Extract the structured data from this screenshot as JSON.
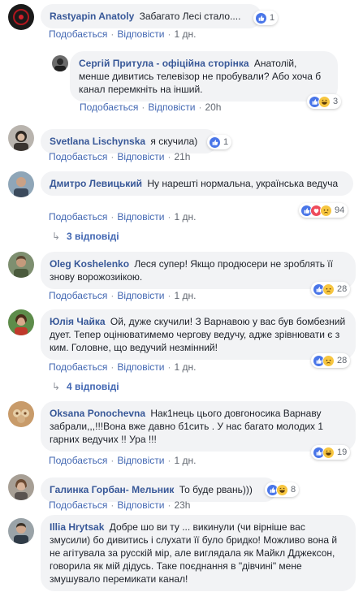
{
  "colors": {
    "name": "#385898",
    "link": "#4267b2",
    "bubble": "#f2f3f5",
    "meta": "#616770"
  },
  "labels": {
    "like": "Подобається",
    "reply": "Відповісти",
    "sep": "·"
  },
  "comments": [
    {
      "name": "Rastyapin Anatoly",
      "text": "Забагато Лесі стало....",
      "time": "1 дн.",
      "reactions": [
        "like"
      ],
      "count": "1"
    },
    {
      "name": "Сергій Притула - офіційна сторінка",
      "text": "Анатолій, менше дивитись телевізор не пробували? Або хоча б канал перемкніть на інший.",
      "time": "20h",
      "reactions": [
        "like",
        "haha"
      ],
      "count": "3"
    },
    {
      "name": "Svetlana Lischynska",
      "text": "я скучила)",
      "time": "21h",
      "reactions": [
        "like"
      ],
      "count": "1"
    },
    {
      "name": "Дмитро Левицький",
      "text": "Ну нарешті нормальна, українська ведуча",
      "time": "1 дн.",
      "reactions": [
        "like",
        "love",
        "sad"
      ],
      "count": "94",
      "replies": "3 відповіді"
    },
    {
      "name": "Oleg Koshelenko",
      "text": "Леся супер! Якщо продюсери не зроблять її знову ворожозиікою.",
      "time": "1 дн.",
      "reactions": [
        "like",
        "sad"
      ],
      "count": "28"
    },
    {
      "name": "Юлія Чайка",
      "text": "Ой, дуже скучили! З Варнавою у вас був бомбезний дует. Тепер оцінюватимемо чергову ведучу, адже зрівнювати є з ким. Головне, що ведучий незмінний!",
      "time": "1 дн.",
      "reactions": [
        "like",
        "sad"
      ],
      "count": "28",
      "replies": "4 відповіді"
    },
    {
      "name": "Oksana Ponochevna",
      "text": "Нак1нець цього довгоносика Варнаву забрали,,,!!!Вона вже давно б1сить . У нас багато молодих 1 гарних ведучих !! Ура !!!",
      "time": "1 дн.",
      "reactions": [
        "like",
        "haha"
      ],
      "count": "19"
    },
    {
      "name": "Галинка Горбан- Мельник",
      "text": "То буде рвань)))",
      "time": "23h",
      "reactions": [
        "like",
        "haha"
      ],
      "count": "8"
    },
    {
      "name": "Illia Hrytsak",
      "text": "Добре шо ви ту ... викинули (чи вірніше вас змусили) бо дивитись і слухати її було бридко! Можливо вона й не агітувала за русскій мір, але виглядала як Майкл Дджексон, говорила як мій дідусь. Таке поєднання в \"дівчині\" мене змушувало перемикати канал!"
    }
  ]
}
